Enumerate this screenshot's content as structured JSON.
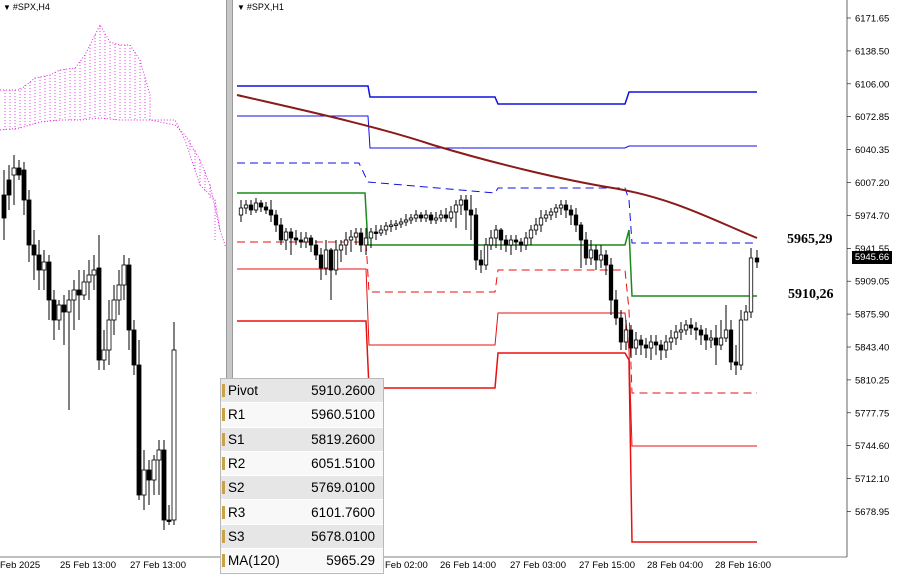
{
  "left_chart": {
    "symbol": "#SPX,H4",
    "x_labels": [
      "Feb 2025",
      "25 Feb 13:00",
      "27 Feb 13:00"
    ]
  },
  "right_chart": {
    "symbol": "#SPX,H1",
    "price_axis": [
      "6171.65",
      "6138.50",
      "6106.00",
      "6072.85",
      "6040.35",
      "6007.20",
      "5974.70",
      "5941.55",
      "5909.05",
      "5875.90",
      "5843.40",
      "5810.25",
      "5777.75",
      "5744.60",
      "5712.10",
      "5678.95"
    ],
    "x_labels": [
      "Feb 02:00",
      "26 Feb 14:00",
      "27 Feb 03:00",
      "27 Feb 15:00",
      "28 Feb 04:00",
      "28 Feb 16:00"
    ],
    "current_price": "5945.66",
    "annotations": [
      "5965,29",
      "5910,26"
    ]
  },
  "levels_table": [
    {
      "name": "Pivot",
      "value": "5910.2600"
    },
    {
      "name": "R1",
      "value": "5960.5100"
    },
    {
      "name": "S1",
      "value": "5819.2600"
    },
    {
      "name": "R2",
      "value": "6051.5100"
    },
    {
      "name": "S2",
      "value": "5769.0100"
    },
    {
      "name": "R3",
      "value": "6101.7600"
    },
    {
      "name": "S3",
      "value": "5678.0100"
    },
    {
      "name": "MA(120)",
      "value": "5965.29"
    }
  ],
  "colors": {
    "pivot": "#1a8a1a",
    "resistance": "#1010e0",
    "support": "#e81010",
    "ma": "#8b1a1a",
    "cloud": "#e020e0",
    "candle": "#000000"
  }
}
